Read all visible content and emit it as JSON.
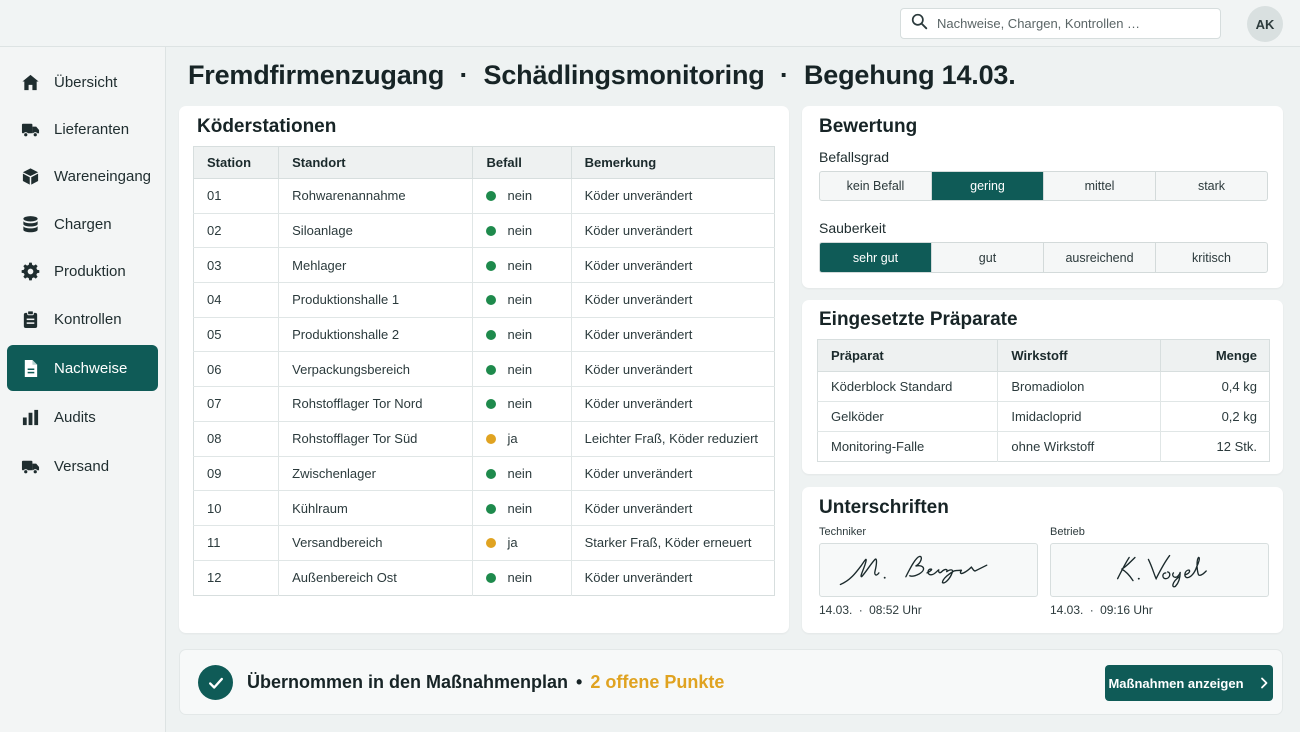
{
  "header": {
    "search_placeholder": "Nachweise, Chargen, Kontrollen …",
    "user_initials": "AK"
  },
  "sidebar": {
    "items": [
      {
        "label": "Übersicht",
        "icon": "home-icon"
      },
      {
        "label": "Lieferanten",
        "icon": "truck-icon"
      },
      {
        "label": "Wareneingang",
        "icon": "box-icon"
      },
      {
        "label": "Chargen",
        "icon": "database-icon"
      },
      {
        "label": "Produktion",
        "icon": "gear-icon"
      },
      {
        "label": "Kontrollen",
        "icon": "clipboard-icon"
      },
      {
        "label": "Nachweise",
        "icon": "document-icon",
        "active": true
      },
      {
        "label": "Audits",
        "icon": "bar-chart-icon"
      },
      {
        "label": "Versand",
        "icon": "truck-icon"
      }
    ]
  },
  "page": {
    "title_part1": "Fremdfirmenzugang",
    "title_part2": "Schädlingsmonitoring",
    "title_part3": "Begehung 14.03.",
    "separator": "·"
  },
  "stations": {
    "title": "Köderstationen",
    "columns": [
      "Station",
      "Standort",
      "Befall",
      "Bemerkung"
    ],
    "rows": [
      {
        "station": "01",
        "standort": "Rohwarenannahme",
        "befall": "nein",
        "status": "ok",
        "bemerkung": "Köder unverändert"
      },
      {
        "station": "02",
        "standort": "Siloanlage",
        "befall": "nein",
        "status": "ok",
        "bemerkung": "Köder unverändert"
      },
      {
        "station": "03",
        "standort": "Mehlager",
        "befall": "nein",
        "status": "ok",
        "bemerkung": "Köder unverändert"
      },
      {
        "station": "04",
        "standort": "Produktionshalle 1",
        "befall": "nein",
        "status": "ok",
        "bemerkung": "Köder unverändert"
      },
      {
        "station": "05",
        "standort": "Produktionshalle 2",
        "befall": "nein",
        "status": "ok",
        "bemerkung": "Köder unverändert"
      },
      {
        "station": "06",
        "standort": "Verpackungsbereich",
        "befall": "nein",
        "status": "ok",
        "bemerkung": "Köder unverändert"
      },
      {
        "station": "07",
        "standort": "Rohstofflager Tor Nord",
        "befall": "nein",
        "status": "ok",
        "bemerkung": "Köder unverändert"
      },
      {
        "station": "08",
        "standort": "Rohstofflager Tor Süd",
        "befall": "ja",
        "status": "warn",
        "bemerkung": "Leichter Fraß, Köder reduziert"
      },
      {
        "station": "09",
        "standort": "Zwischenlager",
        "befall": "nein",
        "status": "ok",
        "bemerkung": "Köder unverändert"
      },
      {
        "station": "10",
        "standort": "Kühlraum",
        "befall": "nein",
        "status": "ok",
        "bemerkung": "Köder unverändert"
      },
      {
        "station": "11",
        "standort": "Versandbereich",
        "befall": "ja",
        "status": "warn",
        "bemerkung": "Starker Fraß, Köder erneuert"
      },
      {
        "station": "12",
        "standort": "Außenbereich Ost",
        "befall": "nein",
        "status": "ok",
        "bemerkung": "Köder unverändert"
      }
    ]
  },
  "rating": {
    "title": "Bewertung",
    "befallsgrad": {
      "label": "Befallsgrad",
      "options": [
        "kein Befall",
        "gering",
        "mittel",
        "stark"
      ],
      "selected": "gering"
    },
    "sauberkeit": {
      "label": "Sauberkeit",
      "options": [
        "sehr gut",
        "gut",
        "ausreichend",
        "kritisch"
      ],
      "selected": "sehr gut"
    }
  },
  "preparations": {
    "title": "Eingesetzte Präparate",
    "columns": [
      "Präparat",
      "Wirkstoff",
      "Menge"
    ],
    "rows": [
      {
        "praeparat": "Köderblock Standard",
        "wirkstoff": "Bromadiolon",
        "menge": "0,4 kg"
      },
      {
        "praeparat": "Gelköder",
        "wirkstoff": "Imidacloprid",
        "menge": "0,2 kg"
      },
      {
        "praeparat": "Monitoring-Falle",
        "wirkstoff": "ohne Wirkstoff",
        "menge": "12 Stk."
      }
    ]
  },
  "signatures": {
    "title": "Unterschriften",
    "items": [
      {
        "role": "Techniker",
        "date": "14.03.",
        "time": "08:52 Uhr",
        "signature": "M. Berger"
      },
      {
        "role": "Betrieb",
        "date": "14.03.",
        "time": "09:16 Uhr",
        "signature": "K. Vogel"
      }
    ]
  },
  "footer": {
    "status_text": "Übernommen in den Maßnahmenplan",
    "separator": "•",
    "open_points": "2 offene Punkte",
    "button_label": "Maßnahmen anzeigen"
  },
  "colors": {
    "primary": "#0f5b57",
    "ok": "#1e8a4c",
    "warn": "#e0a321"
  }
}
